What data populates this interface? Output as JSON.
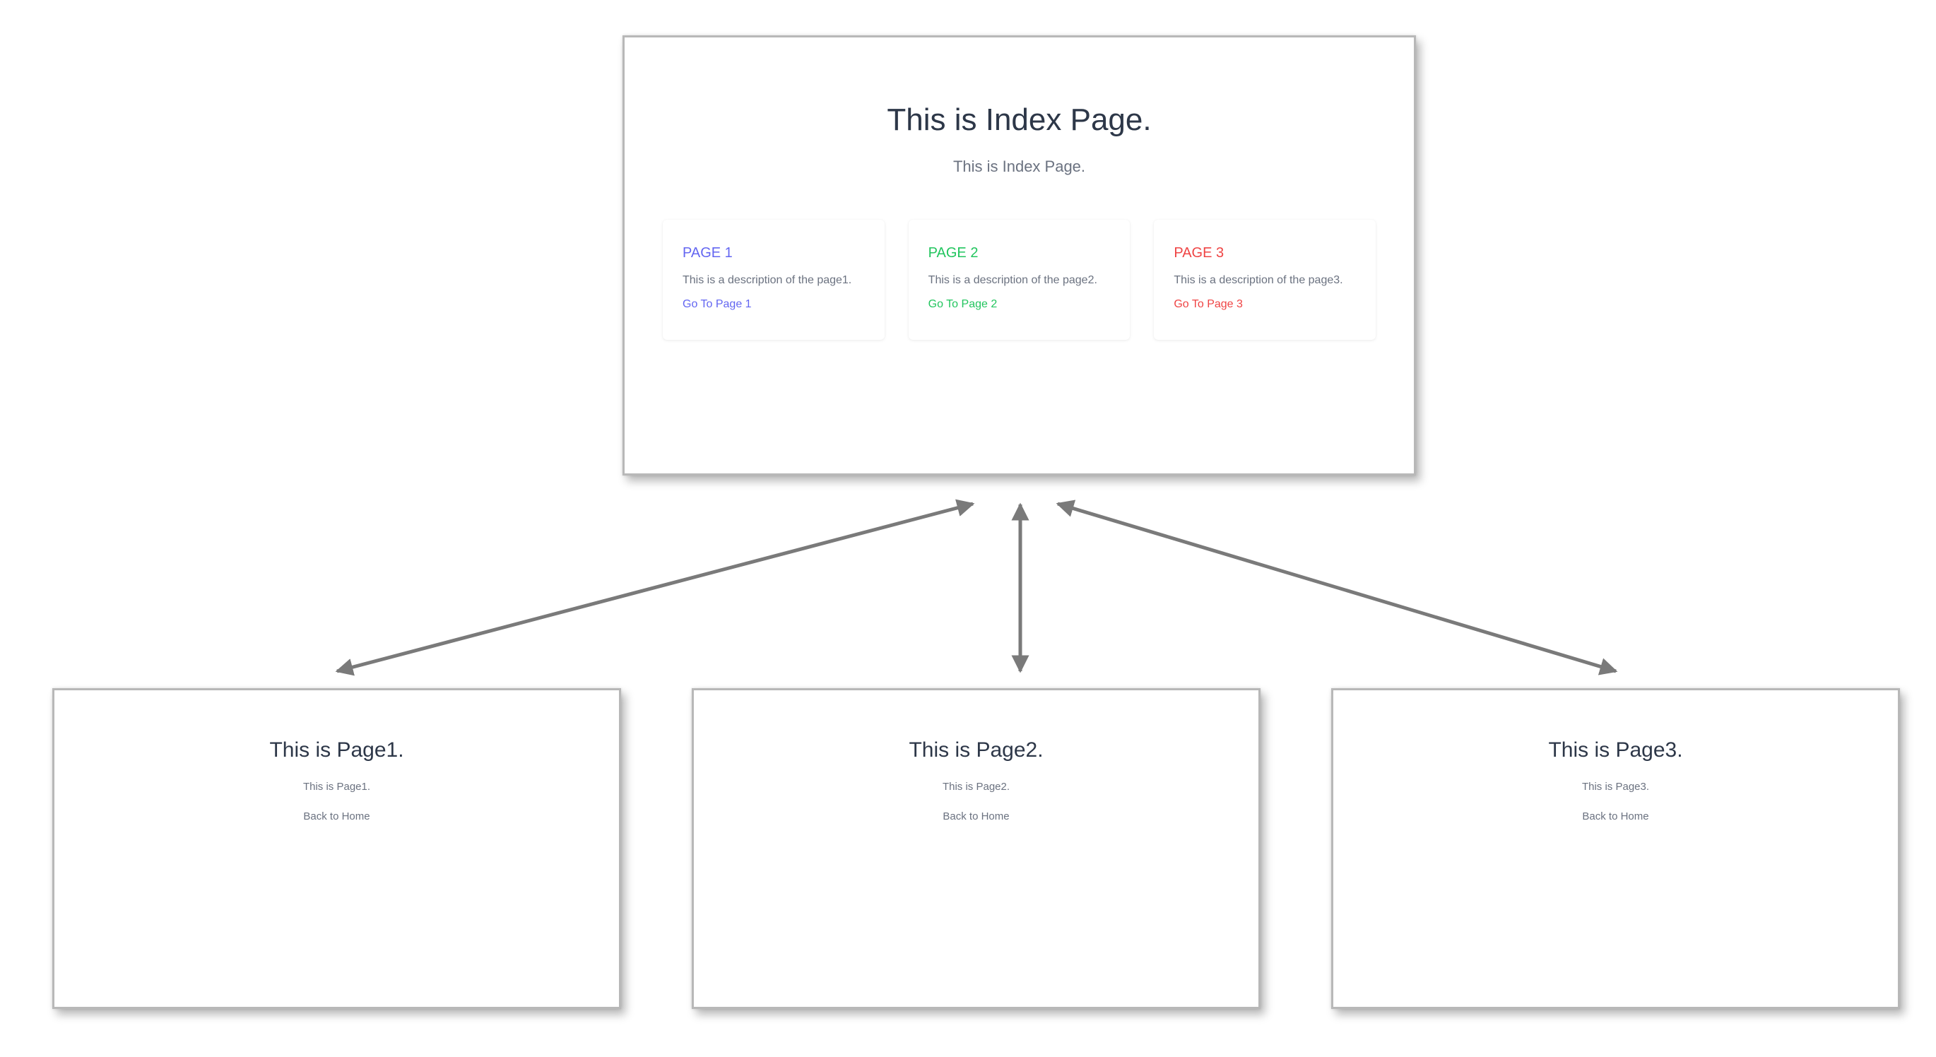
{
  "index": {
    "title": "This is Index Page.",
    "subtitle": "This is Index Page.",
    "cards": [
      {
        "title": "PAGE 1",
        "description": "This is a description of the page1.",
        "link": "Go To Page 1",
        "color": "#6366f1"
      },
      {
        "title": "PAGE 2",
        "description": "This is a description of the page2.",
        "link": "Go To Page 2",
        "color": "#22c55e"
      },
      {
        "title": "PAGE 3",
        "description": "This is a description of the page3.",
        "link": "Go To Page 3",
        "color": "#ef4444"
      }
    ]
  },
  "pages": [
    {
      "title": "This is Page1.",
      "subtitle": "This is Page1.",
      "back": "Back to Home"
    },
    {
      "title": "This is Page2.",
      "subtitle": "This is Page2.",
      "back": "Back to Home"
    },
    {
      "title": "This is Page3.",
      "subtitle": "This is Page3.",
      "back": "Back to Home"
    }
  ],
  "arrow_color": "#7a7a7a"
}
